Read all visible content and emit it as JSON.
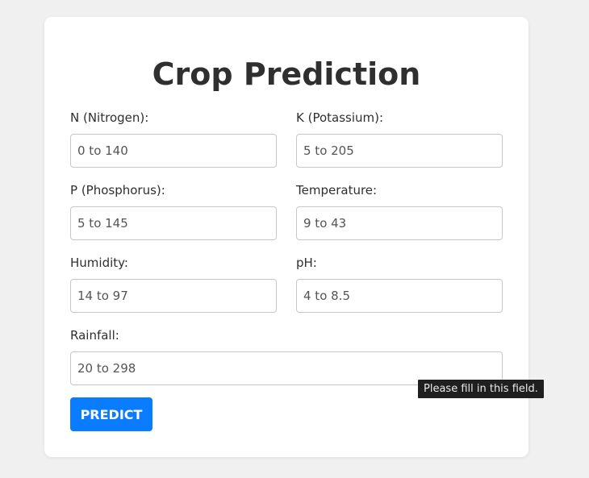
{
  "form": {
    "title": "Crop Prediction",
    "fields": {
      "nitrogen": {
        "label": "N (Nitrogen):",
        "placeholder": "0 to 140",
        "value": ""
      },
      "potassium": {
        "label": "K (Potassium):",
        "placeholder": "5 to 205",
        "value": ""
      },
      "phosphorus": {
        "label": "P (Phosphorus):",
        "placeholder": "5 to 145",
        "value": ""
      },
      "temperature": {
        "label": "Temperature:",
        "placeholder": "9 to 43",
        "value": ""
      },
      "humidity": {
        "label": "Humidity:",
        "placeholder": "14 to 97",
        "value": ""
      },
      "ph": {
        "label": "pH:",
        "placeholder": "4 to 8.5",
        "value": ""
      },
      "rainfall": {
        "label": "Rainfall:",
        "placeholder": "20 to 298",
        "value": ""
      }
    },
    "submit_label": "PREDICT"
  },
  "tooltip": {
    "text": "Please fill in this field."
  },
  "colors": {
    "background": "#f0f0f0",
    "card": "#ffffff",
    "button": "#0a7cff",
    "tooltip": "#1f1f1f"
  }
}
